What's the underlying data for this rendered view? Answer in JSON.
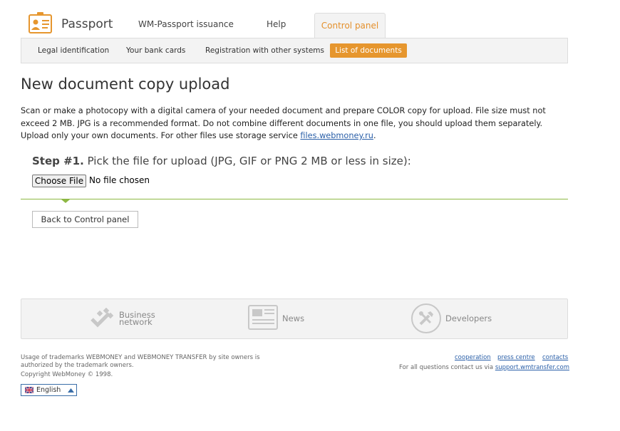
{
  "header": {
    "brand": "Passport",
    "tabs": [
      "WM-Passport issuance",
      "Help",
      "Control panel"
    ],
    "active_tab": "Control panel",
    "subnav": [
      "Legal identification",
      "Your bank cards",
      "Registration with other systems",
      "List of documents"
    ],
    "active_subnav": "List of documents"
  },
  "main": {
    "title": "New document copy upload",
    "intro_text": "Scan or make a photocopy with a digital camera of your needed document and prepare COLOR copy for upload. File size must not exceed 2 MB. JPG is a recommended format. Do not combine different documents in one file, you should upload them separately. Upload only your own documents. For other files use storage service ",
    "intro_link": "files.webmoney.ru",
    "intro_end": ".",
    "step_label": "Step #1.",
    "step_text": " Pick the file for upload (JPG, GIF or PNG 2 MB or less in size):",
    "choose_file": "Choose File",
    "no_file": "No file chosen",
    "back_button": "Back to Control panel"
  },
  "footer_band": {
    "business_line1": "Business",
    "business_line2": "network",
    "news": "News",
    "developers": "Developers"
  },
  "footer": {
    "trademark": "Usage of trademarks WEBMONEY and WEBMONEY TRANSFER by site owners is authorized by the trademark owners.",
    "copyright": "Copyright WebMoney © 1998.",
    "links": [
      "cooperation",
      "press centre",
      "contacts"
    ],
    "support_text": "For all questions contact us via ",
    "support_link": "support.wmtransfer.com",
    "language": "English"
  },
  "colors": {
    "accent": "#e6962e",
    "link": "#2a5fa8",
    "divider": "#8db843"
  }
}
